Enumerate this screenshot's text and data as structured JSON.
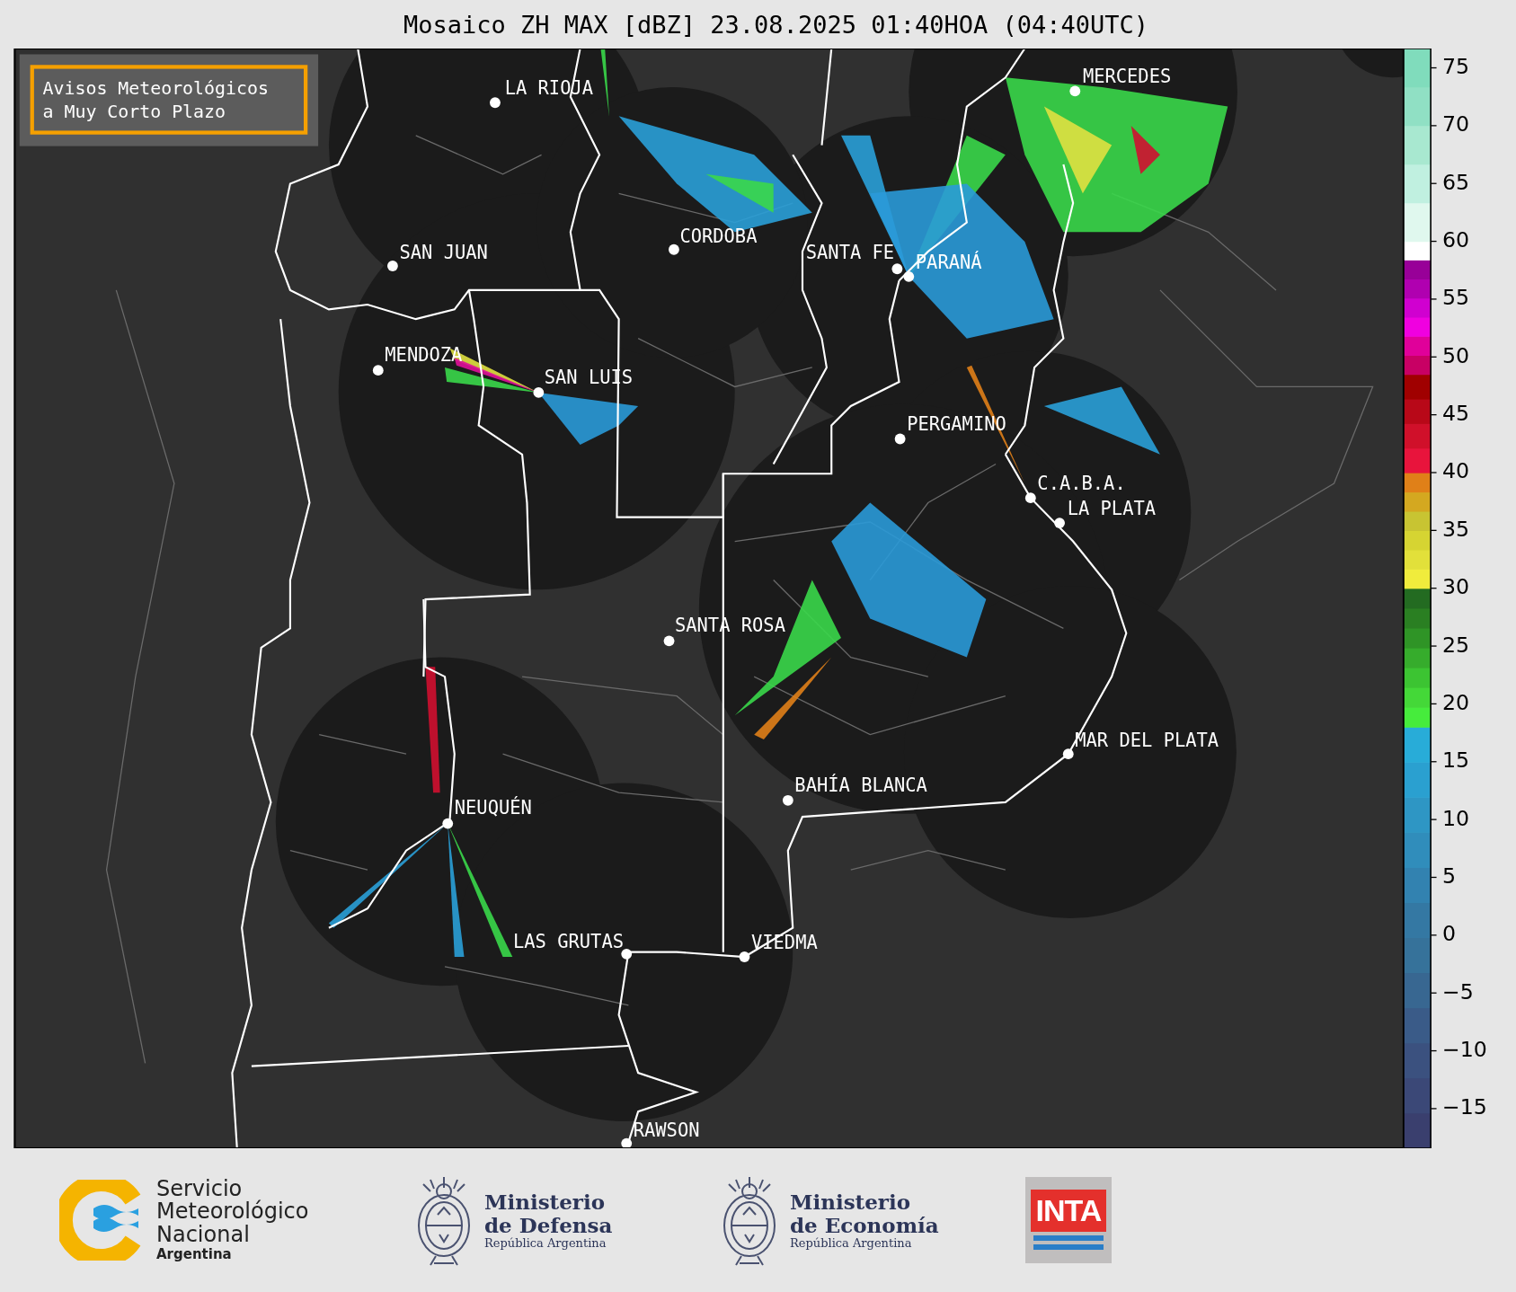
{
  "title": "Mosaico ZH MAX [dBZ] 23.08.2025 01:40HOA (04:40UTC)",
  "map": {
    "notice": "Avisos Meteorológicos\na Muy Corto Plazo",
    "cities": [
      {
        "name": "LA RIOJA"
      },
      {
        "name": "MERCEDES"
      },
      {
        "name": "CORDOBA"
      },
      {
        "name": "SAN JUAN"
      },
      {
        "name": "SANTA FE"
      },
      {
        "name": "PARANÁ"
      },
      {
        "name": "MENDOZA"
      },
      {
        "name": "SAN LUIS"
      },
      {
        "name": "PERGAMINO"
      },
      {
        "name": "C.A.B.A."
      },
      {
        "name": "LA PLATA"
      },
      {
        "name": "SANTA ROSA"
      },
      {
        "name": "MAR DEL PLATA"
      },
      {
        "name": "BAHÍA BLANCA"
      },
      {
        "name": "NEUQUÉN"
      },
      {
        "name": "LAS GRUTAS"
      },
      {
        "name": "VIEDMA"
      },
      {
        "name": "RAWSON"
      }
    ]
  },
  "colorbar": {
    "ticks": [
      "75",
      "70",
      "65",
      "60",
      "55",
      "50",
      "45",
      "40",
      "35",
      "30",
      "25",
      "20",
      "15",
      "10",
      "5",
      "0",
      "−5",
      "−10",
      "−15"
    ]
  },
  "footer": {
    "logos": [
      {
        "kind": "smn",
        "lines": "Servicio\nMeteorológico\nNacional",
        "subtitle": "Argentina"
      },
      {
        "kind": "ministry",
        "lines": "Ministerio\nde Defensa",
        "subtitle": "República Argentina"
      },
      {
        "kind": "ministry",
        "lines": "Ministerio\nde Economía",
        "subtitle": "República Argentina"
      },
      {
        "kind": "inta",
        "lines": "INTA"
      }
    ]
  }
}
